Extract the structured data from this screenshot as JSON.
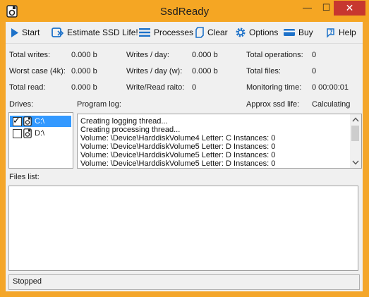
{
  "window": {
    "title": "SsdReady",
    "min_glyph": "—",
    "max_glyph": "☐",
    "close_glyph": "✕"
  },
  "toolbar": {
    "start": "Start",
    "estimate": "Estimate SSD Life!",
    "processes": "Processes",
    "clear": "Clear",
    "options": "Options",
    "buy": "Buy",
    "help": "Help"
  },
  "stats": {
    "total_writes_label": "Total writes:",
    "total_writes_value": "0.000 b",
    "worst_case_label": "Worst case (4k):",
    "worst_case_value": "0.000 b",
    "total_read_label": "Total read:",
    "total_read_value": "0.000 b",
    "writes_day_label": "Writes / day:",
    "writes_day_value": "0.000 b",
    "writes_day_w_label": "Writes / day (w):",
    "writes_day_w_value": "0.000 b",
    "ratio_label": "Write/Read raito:",
    "ratio_value": "0",
    "total_ops_label": "Total operations:",
    "total_ops_value": "0",
    "total_files_label": "Total files:",
    "total_files_value": "0",
    "monitoring_label": "Monitoring time:",
    "monitoring_value": "0 00:00:01",
    "approx_life_label": "Approx ssd life:",
    "approx_life_value": "Calculating"
  },
  "drives": {
    "label": "Drives:",
    "items": [
      {
        "name": "C:\\",
        "checked": true,
        "selected": true
      },
      {
        "name": "D:\\",
        "checked": false,
        "selected": false
      }
    ]
  },
  "program_log": {
    "label": "Program log:",
    "lines": [
      "Creating logging thread...",
      "Creating processing thread...",
      "Volume: \\Device\\HarddiskVolume4  Letter: C  Instances: 0",
      "Volume: \\Device\\HarddiskVolume5  Letter: D  Instances: 0",
      "Volume: \\Device\\HarddiskVolume5  Letter: D  Instances: 0",
      "Volume: \\Device\\HarddiskVolume5  Letter: D  Instances: 0"
    ]
  },
  "files_list": {
    "label": "Files list:"
  },
  "status": {
    "text": "Stopped"
  },
  "colors": {
    "title_bar": "#f5a623",
    "close": "#c7372f",
    "icon_blue": "#1e72c9",
    "selection": "#3399ff"
  }
}
